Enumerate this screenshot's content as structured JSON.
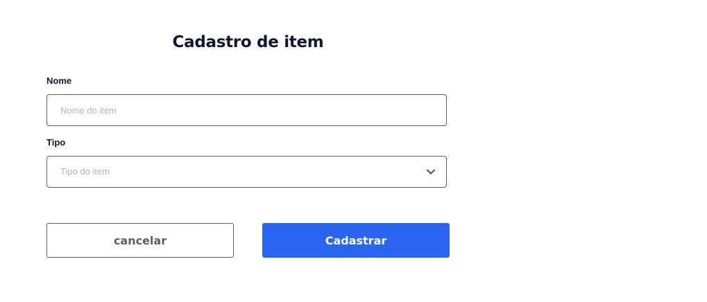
{
  "form": {
    "title": "Cadastro de item",
    "name_field": {
      "label": "Nome",
      "placeholder": "Nome do item",
      "value": ""
    },
    "type_field": {
      "label": "Tipo",
      "placeholder": "Tipo do item",
      "icon": "chevron-down-icon"
    },
    "cancel_label": "cancelar",
    "submit_label": "Cadastrar"
  },
  "colors": {
    "title": "#0f1733",
    "primary": "#2965f1",
    "border": "#5d6066",
    "placeholder": "#b3b3b8",
    "cancel_text": "#5c5f66"
  }
}
